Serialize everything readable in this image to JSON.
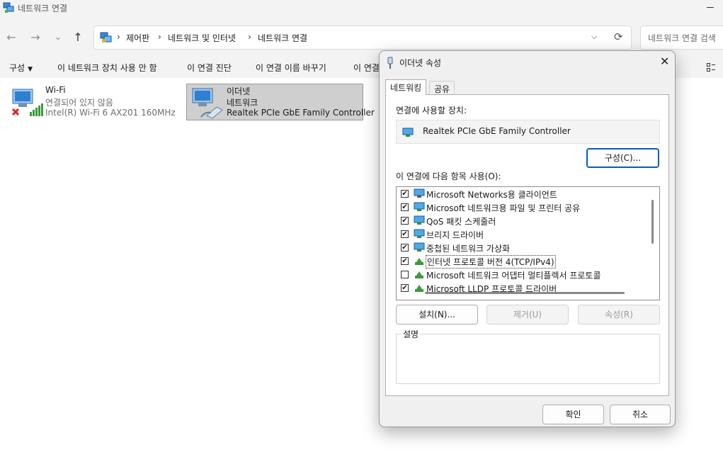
{
  "window": {
    "title": "네트워크 연결"
  },
  "address": {
    "crumbs": [
      "제어판",
      "네트워크 및 인터넷",
      "네트워크 연결"
    ],
    "separator": "›"
  },
  "search": {
    "placeholder": "네트워크 연결 검색"
  },
  "nav": {
    "back": "←",
    "forward": "→",
    "recent": "⌄",
    "up": "↑",
    "dropdown": "⌵",
    "refresh": "⟳"
  },
  "commands": {
    "organize": "구성",
    "disable": "이 네트워크 장치 사용 안 함",
    "diagnose": "이 연결 진단",
    "rename": "이 연결 이름 바꾸기",
    "more": "이 연결"
  },
  "connections": [
    {
      "name": "Wi-Fi",
      "status": "연결되어 있지 않음",
      "device": "Intel(R) Wi-Fi 6 AX201 160MHz"
    },
    {
      "name": "이더넷",
      "status": "네트워크",
      "device": "Realtek PCIe GbE Family Controller"
    }
  ],
  "dialog": {
    "title": "이더넷 속성",
    "close": "✕",
    "tabs": [
      "네트워킹",
      "공유"
    ],
    "connect_using_label": "연결에 사용할 장치:",
    "device_name": "Realtek PCIe GbE Family Controller",
    "configure_button": "구성(C)...",
    "items_label": "이 연결에 다음 항목 사용(O):",
    "items": [
      {
        "label": "Microsoft Networks용 클라이언트",
        "checked": "✔",
        "icon": "network-client-icon"
      },
      {
        "label": "Microsoft 네트워크용 파일 및 프린터 공유",
        "checked": "✔",
        "icon": "network-service-icon"
      },
      {
        "label": "QoS 패킷 스케줄러",
        "checked": "✔",
        "icon": "network-service-icon"
      },
      {
        "label": "브리지 드라이버",
        "checked": "✔",
        "icon": "network-service-icon"
      },
      {
        "label": "중첩된 네트워크 가상화",
        "checked": "✔",
        "icon": "network-service-icon"
      },
      {
        "label": "인터넷 프로토콜 버전 4(TCP/IPv4)",
        "checked": "✔",
        "icon": "protocol-icon"
      },
      {
        "label": "Microsoft 네트워크 어댑터 멀티플렉서 프로토콜",
        "checked": "",
        "icon": "protocol-icon"
      },
      {
        "label": "Microsoft LLDP 프로토콜 드라이버",
        "checked": "✔",
        "icon": "protocol-icon"
      }
    ],
    "install_button": "설치(N)...",
    "uninstall_button": "제거(U)",
    "properties_button": "속성(R)",
    "description_label": "설명",
    "ok_button": "확인",
    "cancel_button": "취소"
  },
  "colors": {
    "accent": "#005fb8",
    "chrome": "#f3f3f3",
    "selection": "#cfcfcf"
  }
}
